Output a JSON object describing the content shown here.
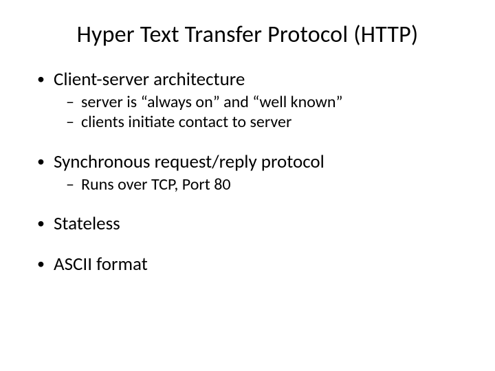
{
  "title": "Hyper Text Transfer Protocol (HTTP)",
  "bullets": {
    "b0": {
      "text": "Client-server architecture",
      "s0": "server is “always on” and “well known”",
      "s1": "clients initiate contact to server"
    },
    "b1": {
      "text": "Synchronous request/reply protocol",
      "s0": "Runs over TCP, Port 80"
    },
    "b2": {
      "text": "Stateless"
    },
    "b3": {
      "text": "ASCII format"
    }
  }
}
